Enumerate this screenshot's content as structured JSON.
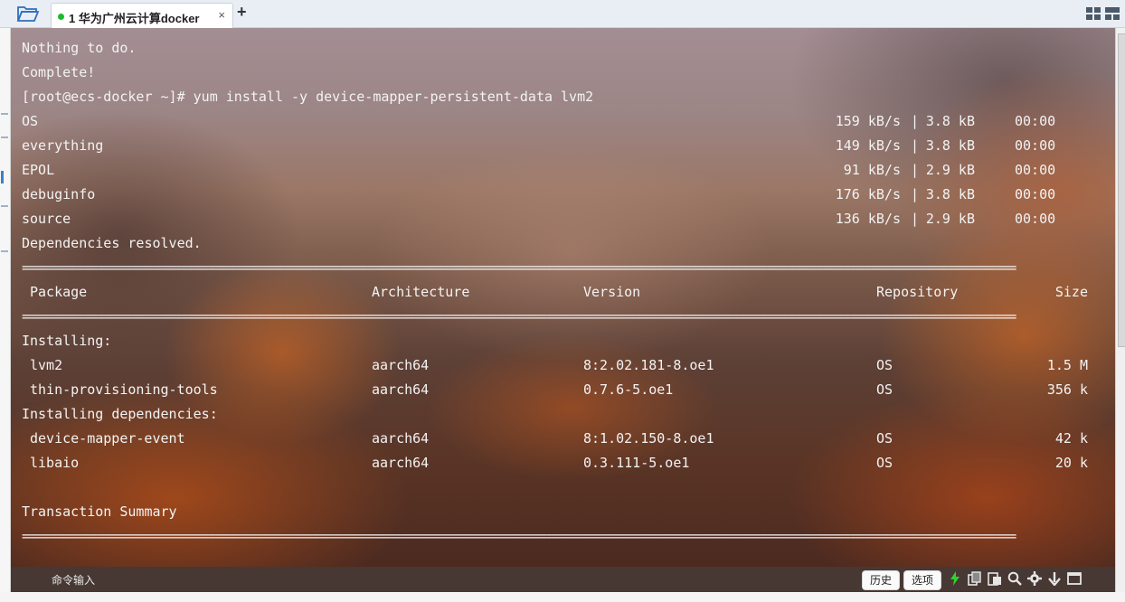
{
  "tab": {
    "number": "1",
    "title": "华为广州云计算docker",
    "close": "×",
    "new": "+"
  },
  "terminal": {
    "lines_top": [
      "Nothing to do.",
      "Complete!",
      "[root@ecs-docker ~]# yum install -y device-mapper-persistent-data lvm2"
    ],
    "repos": [
      {
        "name": "OS",
        "speed": "159 kB/s",
        "size": "3.8 kB",
        "time": "00:00"
      },
      {
        "name": "everything",
        "speed": "149 kB/s",
        "size": "3.8 kB",
        "time": "00:00"
      },
      {
        "name": "EPOL",
        "speed": "91 kB/s",
        "size": "2.9 kB",
        "time": "00:00"
      },
      {
        "name": "debuginfo",
        "speed": "176 kB/s",
        "size": "3.8 kB",
        "time": "00:00"
      },
      {
        "name": "source",
        "speed": "136 kB/s",
        "size": "2.9 kB",
        "time": "00:00"
      }
    ],
    "deps_resolved": "Dependencies resolved.",
    "separator": "================================================================================================================================================",
    "headers": {
      "package": "Package",
      "arch": "Architecture",
      "version": "Version",
      "repo": "Repository",
      "size": "Size"
    },
    "installing_label": "Installing:",
    "installing": [
      {
        "package": "lvm2",
        "arch": "aarch64",
        "version": "8:2.02.181-8.oe1",
        "repo": "OS",
        "size": "1.5 M"
      },
      {
        "package": "thin-provisioning-tools",
        "arch": "aarch64",
        "version": "0.7.6-5.oe1",
        "repo": "OS",
        "size": "356 k"
      }
    ],
    "deps_label": "Installing dependencies:",
    "deps": [
      {
        "package": "device-mapper-event",
        "arch": "aarch64",
        "version": "8:1.02.150-8.oe1",
        "repo": "OS",
        "size": "42 k"
      },
      {
        "package": "libaio",
        "arch": "aarch64",
        "version": "0.3.111-5.oe1",
        "repo": "OS",
        "size": "20 k"
      }
    ],
    "summary": "Transaction Summary"
  },
  "cmdbar": {
    "label": "命令输入",
    "history": "历史",
    "options": "选项"
  }
}
